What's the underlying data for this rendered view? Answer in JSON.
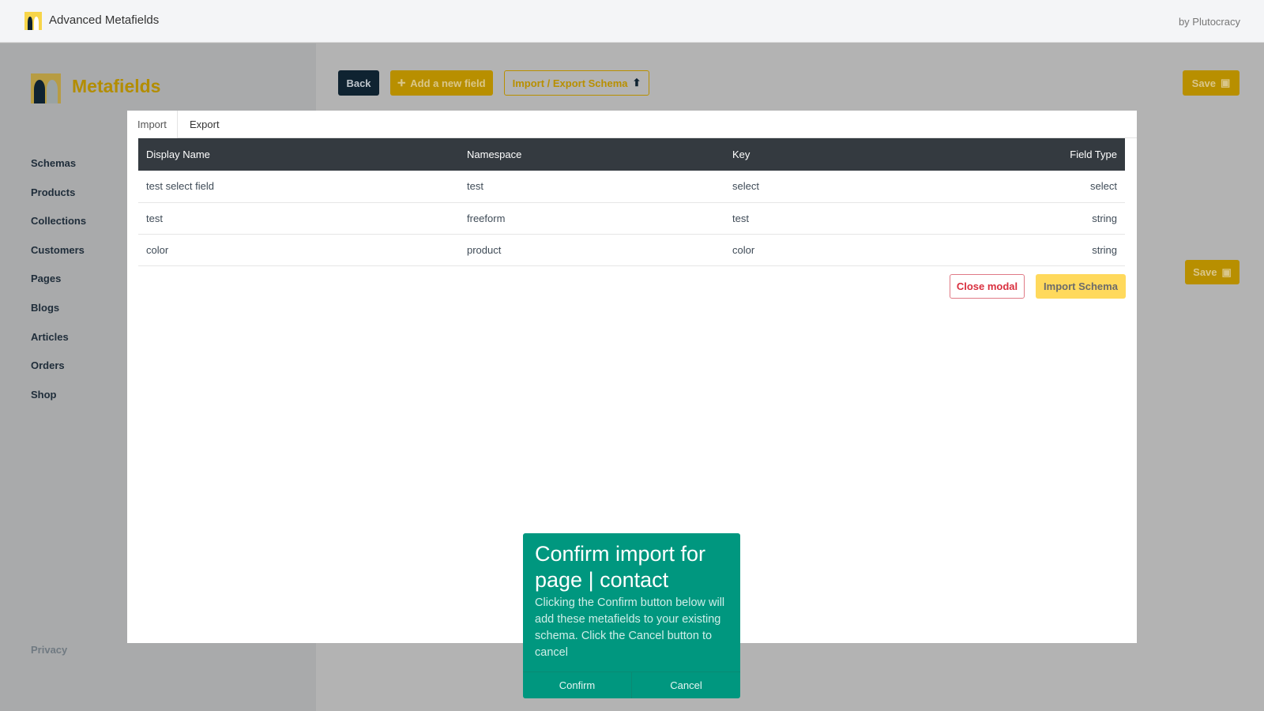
{
  "header": {
    "title": "Advanced Metafields",
    "byline": "by Plutocracy"
  },
  "sidebar": {
    "brand": "Metafields",
    "items": [
      "Schemas",
      "Products",
      "Collections",
      "Customers",
      "Pages",
      "Blogs",
      "Articles",
      "Orders",
      "Shop"
    ],
    "privacy": "Privacy"
  },
  "toolbar": {
    "back": "Back",
    "add_field": "Add a new field",
    "import_export": "Import / Export Schema",
    "save": "Save"
  },
  "modal": {
    "tabs": [
      "Import",
      "Export"
    ],
    "columns": [
      "Display Name",
      "Namespace",
      "Key",
      "Field Type"
    ],
    "rows": [
      [
        "test select field",
        "test",
        "select",
        "select"
      ],
      [
        "test",
        "freeform",
        "test",
        "string"
      ],
      [
        "color",
        "product",
        "color",
        "string"
      ]
    ],
    "close": "Close modal",
    "import": "Import Schema"
  },
  "dialog": {
    "title": "Confirm import for page | contact",
    "body": "Clicking the Confirm button below will add these metafields to your existing schema. Click the Cancel button to cancel",
    "confirm": "Confirm",
    "cancel": "Cancel"
  },
  "colors": {
    "accent": "#b88f00",
    "teal": "#00977f",
    "dark": "#343a40"
  }
}
